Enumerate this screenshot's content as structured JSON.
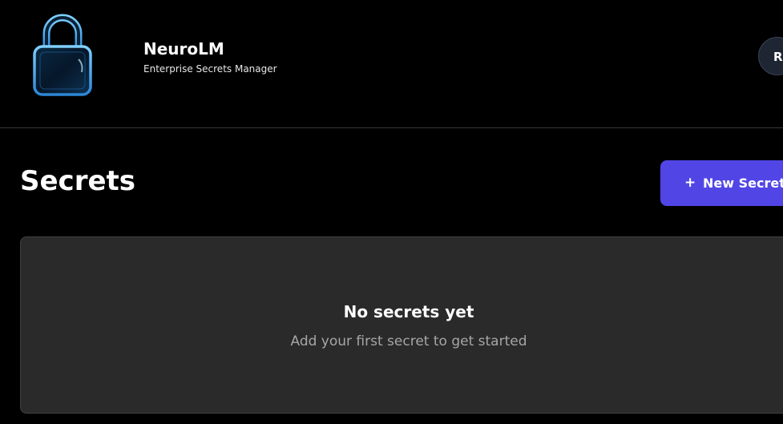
{
  "header": {
    "brand_name": "NeuroLM",
    "tagline": "Enterprise Secrets Manager",
    "logo_icon": "padlock-icon",
    "avatar_initial": "R"
  },
  "main": {
    "title": "Secrets",
    "new_button": {
      "icon": "plus-icon",
      "icon_glyph": "+",
      "label": "New Secret"
    },
    "empty_state": {
      "title": "No secrets yet",
      "subtitle": "Add your first secret to get started"
    }
  },
  "colors": {
    "background": "#000000",
    "accent": "#5146e5",
    "card": "#2a2a2a",
    "logo_glow": "#3aa0e6"
  }
}
